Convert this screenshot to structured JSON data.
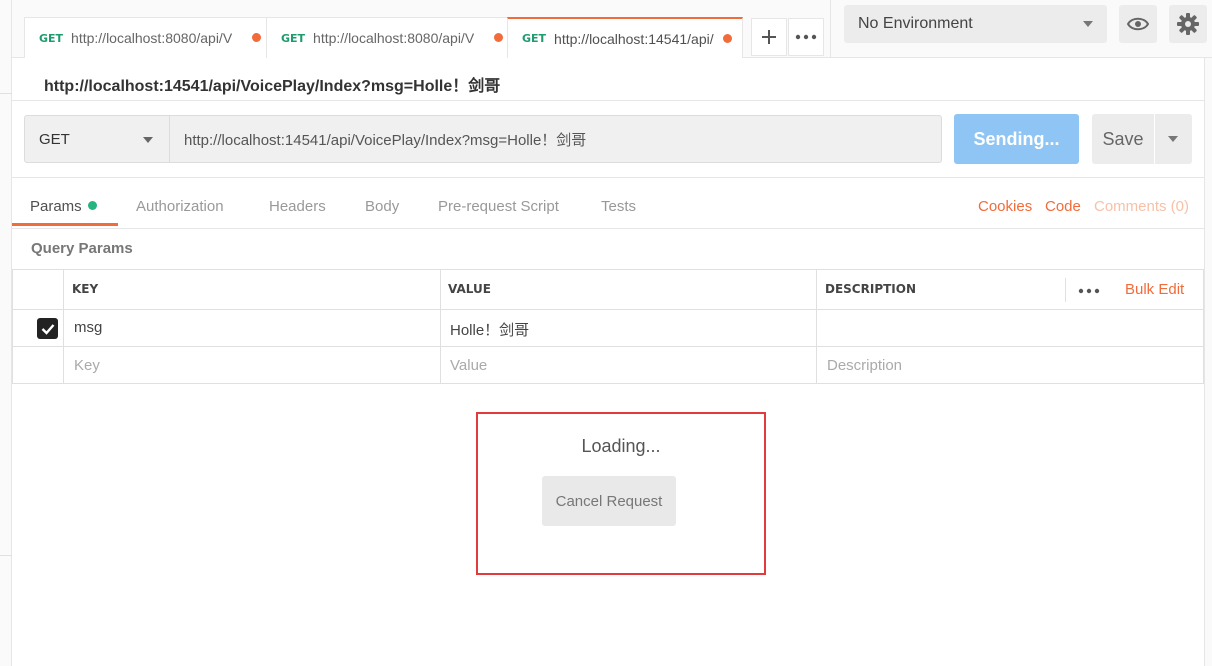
{
  "tabs": [
    {
      "method": "GET",
      "url": "http://localhost:8080/api/V"
    },
    {
      "method": "GET",
      "url": "http://localhost:8080/api/V"
    },
    {
      "method": "GET",
      "url": "http://localhost:14541/api/"
    }
  ],
  "environment": {
    "selected": "No Environment"
  },
  "request": {
    "title": "http://localhost:14541/api/VoicePlay/Index?msg=Holle！剑哥",
    "method": "GET",
    "url": "http://localhost:14541/api/VoicePlay/Index?msg=Holle！剑哥",
    "send_label": "Sending...",
    "save_label": "Save"
  },
  "subtabs": {
    "params": "Params",
    "authorization": "Authorization",
    "headers": "Headers",
    "body": "Body",
    "prerequest": "Pre-request Script",
    "tests": "Tests",
    "cookies": "Cookies",
    "code": "Code",
    "comments": "Comments (0)"
  },
  "params": {
    "section_label": "Query Params",
    "headers": {
      "key": "KEY",
      "value": "VALUE",
      "description": "DESCRIPTION"
    },
    "bulk_edit": "Bulk Edit",
    "rows": [
      {
        "key": "msg",
        "value": "Holle！剑哥",
        "description": "",
        "checked": true
      }
    ],
    "placeholders": {
      "key": "Key",
      "value": "Value",
      "description": "Description"
    }
  },
  "loading": {
    "text": "Loading...",
    "cancel_label": "Cancel Request"
  },
  "colors": {
    "accent": "#f26b3a",
    "send": "#8ec5f4",
    "method_green": "#1e9c6e",
    "highlight_border": "#e13b3b"
  }
}
